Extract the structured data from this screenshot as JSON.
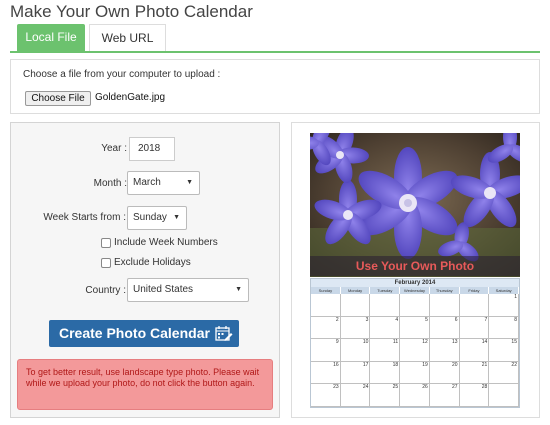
{
  "page": {
    "title": "Make Your Own Photo Calendar"
  },
  "tabs": [
    {
      "label": "Local File",
      "active": true
    },
    {
      "label": "Web URL",
      "active": false
    }
  ],
  "upload": {
    "label": "Choose a file from your computer to upload :",
    "button_label": "Choose File",
    "file_name": "GoldenGate.jpg"
  },
  "form": {
    "year_label": "Year :",
    "year_value": "2018",
    "month_label": "Month :",
    "month_value": "March",
    "week_start_label": "Week Starts from :",
    "week_start_value": "Sunday",
    "include_week_numbers_label": "Include Week Numbers",
    "include_week_numbers_checked": false,
    "exclude_holidays_label": "Exclude Holidays",
    "exclude_holidays_checked": false,
    "country_label": "Country :",
    "country_value": "United States",
    "create_button_label": "Create Photo Calendar",
    "alert_text": "To get better result, use landscape type photo. Please wait while we upload your photo, do not click the button again."
  },
  "preview": {
    "caption": "Use Your Own Photo",
    "calendar_title": "February 2014",
    "weekdays": [
      "Sunday",
      "Monday",
      "Tuesday",
      "Wednesday",
      "Thursday",
      "Friday",
      "Saturday"
    ],
    "weeks": [
      [
        "",
        "",
        "",
        "",
        "",
        "",
        "1"
      ],
      [
        "2",
        "3",
        "4",
        "5",
        "6",
        "7",
        "8"
      ],
      [
        "9",
        "10",
        "11",
        "12",
        "13",
        "14",
        "15"
      ],
      [
        "16",
        "17",
        "18",
        "19",
        "20",
        "21",
        "22"
      ],
      [
        "23",
        "24",
        "25",
        "26",
        "27",
        "28",
        ""
      ]
    ]
  },
  "colors": {
    "tab_active": "#6cc26e",
    "button_primary": "#2b6aa6",
    "alert_background": "#f3999a",
    "alert_text": "#b01818"
  }
}
